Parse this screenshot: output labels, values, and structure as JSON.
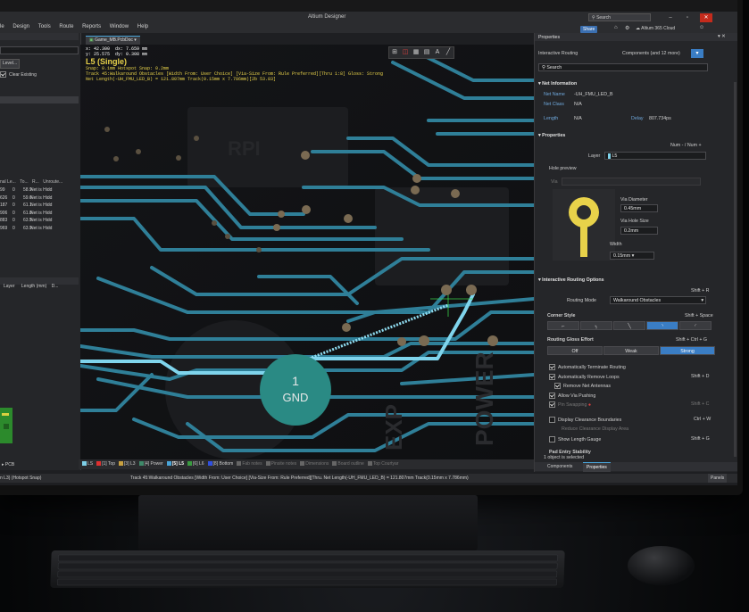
{
  "app": {
    "title": "Altium Designer",
    "search_placeholder": "Search",
    "share_label": "Share",
    "cloud_label": "Altium 365 Cloud"
  },
  "menu": [
    "le",
    "Design",
    "Tools",
    "Route",
    "Reports",
    "Window",
    "Help"
  ],
  "left_panel": {
    "level_button": "Level...",
    "clear_existing": "Clear Existing",
    "table_headers": [
      "nal Le...",
      "To...",
      "R...",
      "Unroute..."
    ],
    "rows": [
      [
        "99",
        "0",
        "58.9",
        "Net is Hidd"
      ],
      [
        "626",
        "0",
        "59.6",
        "Net is Hidd"
      ],
      [
        "187",
        "0",
        "61.1",
        "Net is Hidd"
      ],
      [
        "906",
        "0",
        "61.8",
        "Net is Hidd"
      ],
      [
        "883",
        "0",
        "63.5",
        "Net is Hidd"
      ],
      [
        "969",
        "0",
        "63.9",
        "Net is Hidd"
      ]
    ],
    "headers2": [
      "Layer",
      "Length (mm)",
      "D..."
    ],
    "pcb_tab": "PCB"
  },
  "document_tab": "Game_MB.PcbDoc",
  "hud": {
    "coord_x": "x: 42.300",
    "dx": "dx: 7.659 mm",
    "coord_y": "y: 25.575",
    "dy": "dy: 0.308 mm",
    "layer": "L5 (Single)",
    "snap": "Snap: 0.1mm Hotspot Snap: 0.2mm",
    "track": "Track 45:Walkaround Obstacles [Width From: User Choice] [Via-Size From: Rule Preferred][Thru 1:8] Gloss: Strong",
    "net": "Net Length(-UH_FMU_LED_B) = 121.807mm Track(0.15mm x 7.786mm)[2b 53.83]"
  },
  "board_text": {
    "gnd_number": "1",
    "gnd_label": "GND",
    "rp_silk": "RPI",
    "exp_silk": "EXP",
    "power_silk": "POWER"
  },
  "layer_bar": [
    {
      "label": "LS",
      "color": "#7ed0e8"
    },
    {
      "label": "[1] Top",
      "color": "#e03030"
    },
    {
      "label": "[3] L3",
      "color": "#c8a040"
    },
    {
      "label": "[4] Power",
      "color": "#3f8a6a"
    },
    {
      "label": "[5] L5",
      "color": "#49a4d8"
    },
    {
      "label": "[6] L6",
      "color": "#3a9a40"
    },
    {
      "label": "[8] Bottom",
      "color": "#3050e0"
    },
    {
      "label": "Fab notes",
      "color": "#666666"
    },
    {
      "label": "Pinsite notes",
      "color": "#666666"
    },
    {
      "label": "Dimensions",
      "color": "#666666"
    },
    {
      "label": "Board outline",
      "color": "#666666"
    },
    {
      "label": "Top Courtyar",
      "color": "#666666"
    }
  ],
  "status_bar": {
    "left": "n L3)   (Hotspot Snap)",
    "main": "Track 45:Walkaround Obstacles [Width From: User Choice] [Via-Size From: Rule Preferred][Thru.   Net Length(-UH_FMU_LED_B) = 121.807mm Track(0.15mm x 7.786mm)",
    "panels": "Panels"
  },
  "properties": {
    "panel_title": "Properties",
    "mode": "Interactive Routing",
    "filter": "Components (and 12 more)",
    "search_placeholder": "Search",
    "net_info_title": "Net Information",
    "net_name_label": "Net Name",
    "net_name": "-UH_FMU_LED_B",
    "net_class_label": "Net Class",
    "net_class": "N/A",
    "length_label": "Length",
    "length": "N/A",
    "delay_label": "Delay",
    "delay": "807.734ps",
    "props_title": "Properties",
    "num_label": "Num - / Num +",
    "layer_label": "Layer",
    "layer_value": "L5",
    "hole_preview": "Hole preview",
    "via_label": "Via",
    "via_diameter_label": "Via Diameter",
    "via_diameter": "0.45mm",
    "via_hole_label": "Via Hole Size",
    "via_hole": "0.2mm",
    "width_label": "Width",
    "width": "0.15mm",
    "iro_title": "Interactive Routing Options",
    "iro_shortcut": "Shift + R",
    "routing_mode_label": "Routing Mode",
    "routing_mode": "Walkaround Obstacles",
    "corner_style_label": "Corner Style",
    "corner_shortcut": "Shift + Space",
    "gloss_label": "Routing Gloss Effort",
    "gloss_shortcut": "Shift + Ctrl + G",
    "gloss_options": [
      "Off",
      "Weak",
      "Strong"
    ],
    "opt_auto_terminate": "Automatically Terminate Routing",
    "opt_auto_remove": "Automatically Remove Loops",
    "opt_auto_remove_sc": "Shift + D",
    "opt_remove_antennas": "Remove Net Antennas",
    "opt_via_pushing": "Allow Via Pushing",
    "opt_pin_swapping": "Pin Swapping",
    "opt_pin_sc": "Shift + C",
    "opt_clearance": "Display Clearance Boundaries",
    "opt_clearance_sc": "Ctrl + W",
    "opt_reduce": "Reduce Clearance Display Area",
    "opt_length_gauge": "Show Length Gauge",
    "opt_length_sc": "Shift + G",
    "opt_pad_entry": "Pad Entry Stability",
    "selected": "1 object is selected",
    "tab_components": "Components",
    "tab_properties": "Properties"
  }
}
